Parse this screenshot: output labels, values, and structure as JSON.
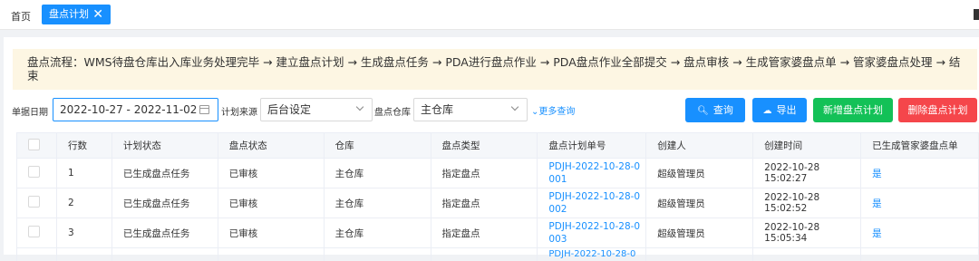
{
  "tabs": {
    "home": "首页",
    "active": "盘点计划",
    "close": "✕"
  },
  "flow_text": "盘点流程：WMS待盘仓库出入库业务处理完毕 → 建立盘点计划 → 生成盘点任务 → PDA进行盘点作业 → PDA盘点作业全部提交 → 盘点审核 → 生成管家婆盘点单 → 管家婆盘点处理 → 结束",
  "filters": {
    "date_label": "单据日期",
    "date_value": "2022-10-27 - 2022-11-02",
    "source_label": "计划来源",
    "source_value": "后台设定",
    "warehouse_label": "盘点仓库",
    "warehouse_value": "主仓库",
    "more_query": "⌄更多查询"
  },
  "buttons": {
    "search": "查询",
    "export": "导出",
    "add": "新增盘点计划",
    "delete": "删除盘点计划"
  },
  "table": {
    "headers": [
      "行数",
      "计划状态",
      "盘点状态",
      "仓库",
      "盘点类型",
      "盘点计划单号",
      "创建人",
      "创建时间",
      "已生成管家婆盘点单"
    ],
    "rows": [
      [
        "1",
        "已生成盘点任务",
        "已审核",
        "主仓库",
        "指定盘点",
        "PDJH-2022-10-28-0 001",
        "超级管理员",
        "2022-10-28 15:02:27",
        "是"
      ],
      [
        "2",
        "已生成盘点任务",
        "已审核",
        "主仓库",
        "指定盘点",
        "PDJH-2022-10-28-0 002",
        "超级管理员",
        "2022-10-28 15:02:52",
        "是"
      ],
      [
        "3",
        "已生成盘点任务",
        "已审核",
        "主仓库",
        "指定盘点",
        "PDJH-2022-10-28-0 003",
        "超级管理员",
        "2022-10-28 15:05:34",
        "是"
      ]
    ],
    "partial_row_no": "PDJH-2022-10-28-0"
  }
}
